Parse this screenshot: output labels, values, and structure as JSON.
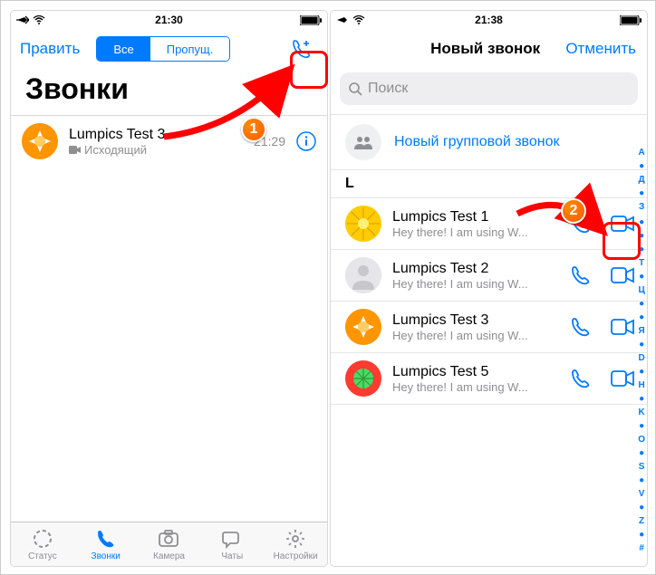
{
  "left": {
    "status": {
      "time": "21:30"
    },
    "nav": {
      "edit": "Править",
      "seg_all": "Все",
      "seg_missed": "Пропущ."
    },
    "title": "Звонки",
    "call": {
      "name": "Lumpics Test 3",
      "direction": "Исходящий",
      "time": "21:29"
    },
    "tabs": {
      "status": "Статус",
      "calls": "Звонки",
      "camera": "Камера",
      "chats": "Чаты",
      "settings": "Настройки"
    }
  },
  "right": {
    "status": {
      "time": "21:38"
    },
    "nav": {
      "title": "Новый звонок",
      "cancel": "Отменить"
    },
    "search_placeholder": "Поиск",
    "group_call": "Новый групповой звонок",
    "section": "L",
    "contacts": [
      {
        "name": "Lumpics Test 1",
        "sub": "Hey there! I am using W..."
      },
      {
        "name": "Lumpics Test 2",
        "sub": "Hey there! I am using W..."
      },
      {
        "name": "Lumpics Test 3",
        "sub": "Hey there! I am using W..."
      },
      {
        "name": "Lumpics Test 5",
        "sub": "Hey there! I am using W..."
      }
    ],
    "index": [
      "А",
      "●",
      "Д",
      "●",
      "З",
      "",
      "●",
      "●",
      "●",
      "Т",
      "●",
      "Ц",
      "●",
      "●",
      "Я",
      "●",
      "D",
      "●",
      "H",
      "●",
      "K",
      "●",
      "O",
      "●",
      "S",
      "●",
      "V",
      "●",
      "Z",
      "●",
      "#"
    ]
  },
  "steps": {
    "one": "1",
    "two": "2"
  }
}
